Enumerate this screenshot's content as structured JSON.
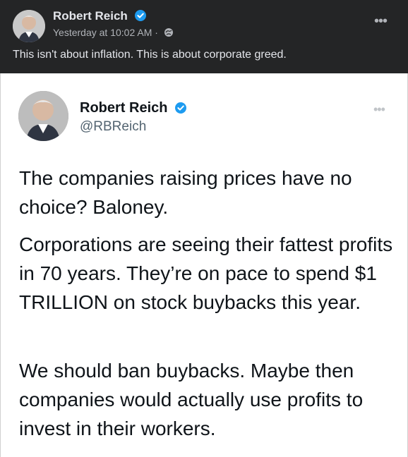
{
  "post": {
    "author": "Robert Reich",
    "time": "Yesterday at 10:02 AM · ",
    "caption": "This isn't about inflation. This is about corporate greed.",
    "more": "•••"
  },
  "tweet": {
    "name": "Robert Reich",
    "handle": "@RBReich",
    "more": "•••",
    "paragraphs": [
      "The companies raising prices have no choice? Baloney.",
      "Corporations are seeing their fattest profits in 70 years. They’re on pace to spend $1 TRILLION on stock buybacks this year.",
      "We should ban buybacks. Maybe then companies would actually use profits to invest in their workers."
    ]
  },
  "colors": {
    "facebook_bg": "#242526",
    "verified_blue": "#1d9bf0",
    "tweet_bg": "#ffffff"
  },
  "icons": {
    "verified": "verified-badge-icon",
    "globe": "globe-icon",
    "more": "more-options-icon"
  }
}
